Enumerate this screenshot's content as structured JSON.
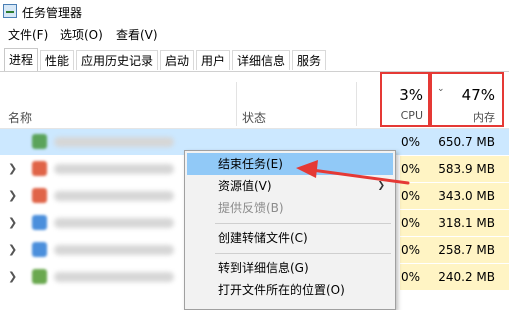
{
  "window": {
    "title": "任务管理器"
  },
  "menubar": [
    "文件(F)",
    "选项(O)",
    "查看(V)"
  ],
  "tabs": [
    "进程",
    "性能",
    "应用历史记录",
    "启动",
    "用户",
    "详细信息",
    "服务"
  ],
  "columns": {
    "name": "名称",
    "status": "状态",
    "cpu_percent": "3%",
    "cpu_label": "CPU",
    "mem_percent": "47%",
    "mem_label": "内存"
  },
  "processes": [
    {
      "cpu": "0%",
      "memory": "650.7 MB",
      "selected": true,
      "icon_color": "#5ba35b"
    },
    {
      "cpu": "0%",
      "memory": "583.9 MB",
      "icon_color": "#e06448"
    },
    {
      "cpu": "0%",
      "memory": "343.0 MB",
      "icon_color": "#e06448"
    },
    {
      "cpu": "0%",
      "memory": "318.1 MB",
      "icon_color": "#4b8fdc"
    },
    {
      "cpu": "0%",
      "memory": "258.7 MB",
      "icon_color": "#4b8fdc"
    },
    {
      "cpu": "0%",
      "memory": "240.2 MB",
      "icon_color": "#6aa84f"
    }
  ],
  "context_menu": {
    "end_task": "结束任务(E)",
    "resource_values": "资源值(V)",
    "provide_feedback": "提供反馈(B)",
    "create_dump": "创建转储文件(C)",
    "go_to_details": "转到详细信息(G)",
    "open_file_location": "打开文件所在的位置(O)"
  },
  "colors": {
    "annotation": "#e53935",
    "selected_row": "#cce8ff",
    "highlight": "#91c9f7",
    "heat": "#fff4c4"
  }
}
